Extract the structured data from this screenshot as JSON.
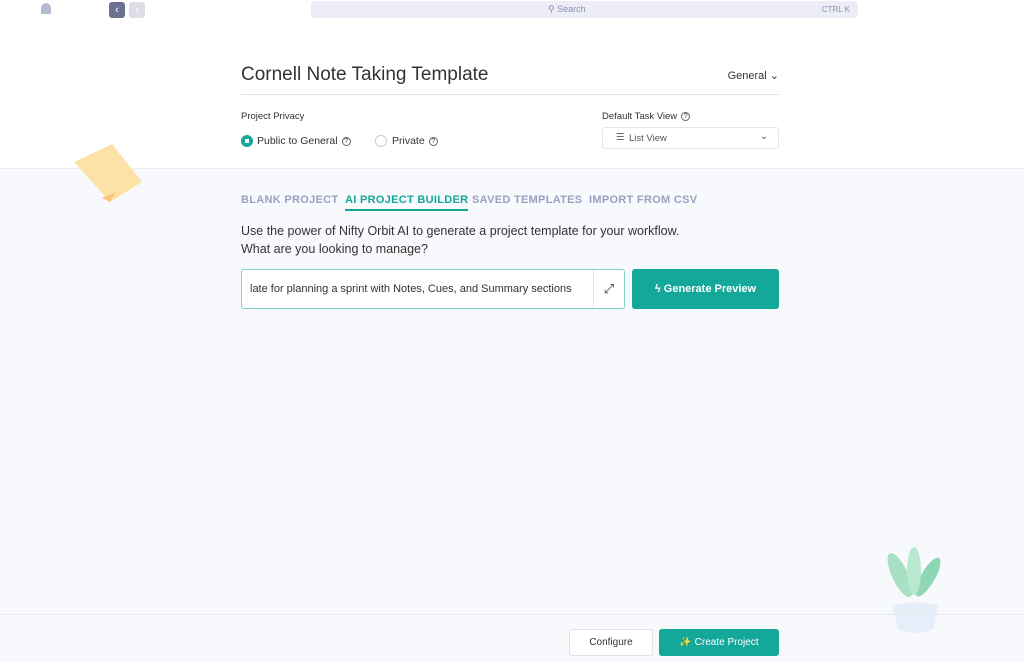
{
  "topbar": {
    "search_placeholder": "Search",
    "shortcut": "CTRL K",
    "back": "‹",
    "forward": "›"
  },
  "header": {
    "title": "Cornell Note Taking Template",
    "workspace": "General"
  },
  "privacy": {
    "label": "Project Privacy",
    "options": [
      {
        "label": "Public to General",
        "selected": true
      },
      {
        "label": "Private",
        "selected": false
      }
    ]
  },
  "task_view": {
    "label": "Default Task View",
    "value": "List View"
  },
  "tabs": [
    {
      "label": "BLANK PROJECT"
    },
    {
      "label": "AI PROJECT BUILDER",
      "active": true
    },
    {
      "label": "SAVED TEMPLATES"
    },
    {
      "label": "IMPORT FROM CSV"
    }
  ],
  "ai": {
    "line1": "Use the power of Nifty Orbit AI to generate a project template for your workflow.",
    "line2": "What are you looking to manage?",
    "input_value": "late for planning a sprint with Notes, Cues, and Summary sections",
    "generate": "Generate Preview"
  },
  "footer": {
    "configure": "Configure",
    "create": "Create Project"
  },
  "colors": {
    "accent": "#13a89a"
  }
}
